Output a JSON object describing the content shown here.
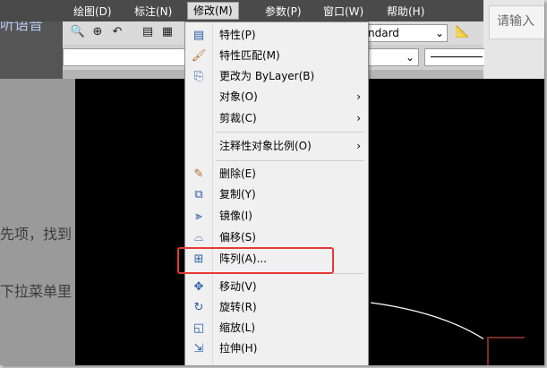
{
  "left_title": "听语音",
  "menubar": {
    "items": [
      "绘图(D)",
      "标注(N)",
      "修改(M)",
      "参数(P)",
      "窗口(W)",
      "帮助(H)"
    ],
    "active": "修改(M)"
  },
  "search": {
    "placeholder": "请输入"
  },
  "toolbar": {
    "style_combo": "ndard",
    "layer_combo": ""
  },
  "left_doc": {
    "line1": "先项，找到",
    "line2": "下拉菜单里"
  },
  "menu": {
    "items": [
      {
        "label": "特性(P)",
        "icon": "properties-icon"
      },
      {
        "label": "特性匹配(M)",
        "icon": "match-properties-icon"
      },
      {
        "label": "更改为 ByLayer(B)",
        "icon": "bylayer-icon"
      },
      {
        "label": "对象(O)",
        "submenu": true
      },
      {
        "label": "剪裁(C)",
        "submenu": true
      },
      {
        "label": "注释性对象比例(O)",
        "submenu": true
      },
      {
        "label": "删除(E)",
        "icon": "erase-icon"
      },
      {
        "label": "复制(Y)",
        "icon": "copy-icon"
      },
      {
        "label": "镜像(I)",
        "icon": "mirror-icon"
      },
      {
        "label": "偏移(S)",
        "icon": "offset-icon"
      },
      {
        "label": "阵列(A)...",
        "icon": "array-icon"
      },
      {
        "label": "移动(V)",
        "icon": "move-icon"
      },
      {
        "label": "旋转(R)",
        "icon": "rotate-icon"
      },
      {
        "label": "缩放(L)",
        "icon": "scale-icon"
      },
      {
        "label": "拉伸(H)",
        "icon": "stretch-icon"
      }
    ],
    "highlighted": "阵列(A)...",
    "submenu_arrow": "›"
  },
  "colors": {
    "highlight_border": "#e53935",
    "menubar": "#4a4a4a",
    "canvas": "#000000"
  }
}
